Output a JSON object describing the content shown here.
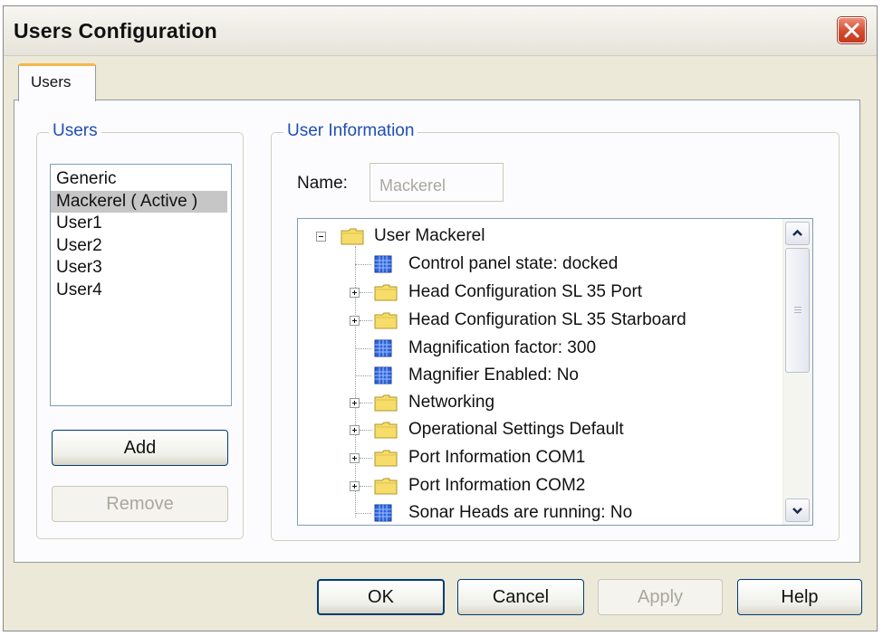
{
  "window": {
    "title": "Users Configuration"
  },
  "tabs": [
    {
      "label": "Users",
      "active": true
    }
  ],
  "users_group": {
    "legend": "Users",
    "items": [
      "Generic",
      "Mackerel ( Active )",
      "User1",
      "User2",
      "User3",
      "User4"
    ],
    "selected_index": 1,
    "add_label": "Add",
    "remove_label": "Remove"
  },
  "info_group": {
    "legend": "User Information",
    "name_label": "Name:",
    "name_value": "Mackerel"
  },
  "tree": {
    "root": "User Mackerel",
    "nodes": [
      {
        "label": "Control panel state: docked",
        "kind": "setting"
      },
      {
        "label": "Head Configuration SL 35 Port",
        "kind": "folder"
      },
      {
        "label": "Head Configuration SL 35 Starboard",
        "kind": "folder"
      },
      {
        "label": "Magnification factor: 300",
        "kind": "setting"
      },
      {
        "label": "Magnifier Enabled: No",
        "kind": "setting"
      },
      {
        "label": "Networking",
        "kind": "folder"
      },
      {
        "label": "Operational Settings Default",
        "kind": "folder"
      },
      {
        "label": "Port Information COM1",
        "kind": "folder"
      },
      {
        "label": "Port Information COM2",
        "kind": "folder"
      },
      {
        "label": "Sonar Heads are running: No",
        "kind": "setting"
      }
    ]
  },
  "footer": {
    "ok_label": "OK",
    "cancel_label": "Cancel",
    "apply_label": "Apply",
    "help_label": "Help"
  },
  "colors": {
    "accent_tab": "#f2b94a",
    "legend_text": "#1f4fb4",
    "close_button": "#d44a2e"
  }
}
